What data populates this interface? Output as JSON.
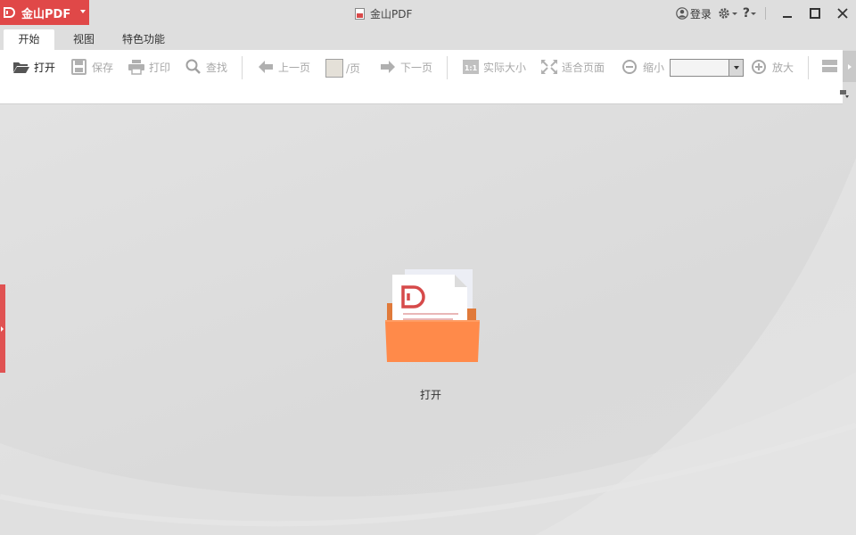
{
  "titlebar": {
    "app_name": "金山PDF",
    "window_title": "金山PDF",
    "login_label": "登录",
    "help_label": "?",
    "brand_color": "#e04848"
  },
  "tabs": [
    {
      "label": "开始",
      "active": true
    },
    {
      "label": "视图",
      "active": false
    },
    {
      "label": "特色功能",
      "active": false
    }
  ],
  "toolbar": {
    "open": "打开",
    "save": "保存",
    "print": "打印",
    "find": "查找",
    "prev_page": "上一页",
    "page_suffix": "/页",
    "next_page": "下一页",
    "actual_size": "实际大小",
    "fit_page": "适合页面",
    "zoom_out": "缩小",
    "zoom_value": "",
    "zoom_in": "放大"
  },
  "icons": {
    "open": "folder-open-icon",
    "save": "floppy-icon",
    "print": "printer-icon",
    "find": "magnifier-icon",
    "prev": "arrow-left-icon",
    "next": "arrow-right-icon",
    "actual": "one-to-one-icon",
    "fit": "fit-arrows-icon",
    "zoom_out": "zoom-out-icon",
    "zoom_in": "zoom-in-icon"
  },
  "workspace": {
    "open_label": "打开",
    "accent_orange": "#ff8a4a"
  }
}
